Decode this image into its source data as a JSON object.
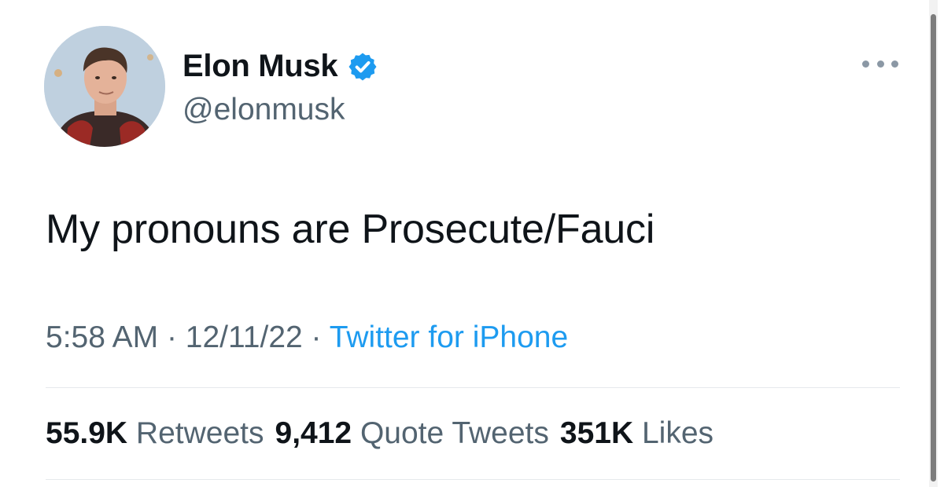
{
  "author": {
    "display_name": "Elon Musk",
    "handle": "@elonmusk",
    "verified": true,
    "verified_color": "#1d9bf0"
  },
  "tweet": {
    "text": "My pronouns are Prosecute/Fauci",
    "time": "5:58 AM",
    "separator": "·",
    "date": "12/11/22",
    "source": "Twitter for iPhone"
  },
  "stats": {
    "retweets": {
      "count": "55.9K",
      "label": "Retweets"
    },
    "quote_tweets": {
      "count": "9,412",
      "label": "Quote Tweets"
    },
    "likes": {
      "count": "351K",
      "label": "Likes"
    }
  },
  "icons": {
    "verified": "verified-badge-icon",
    "more": "more-options-icon"
  },
  "colors": {
    "text": "#0f1419",
    "secondary": "#536471",
    "link": "#1d9bf0",
    "divider": "#e6e9ec"
  }
}
